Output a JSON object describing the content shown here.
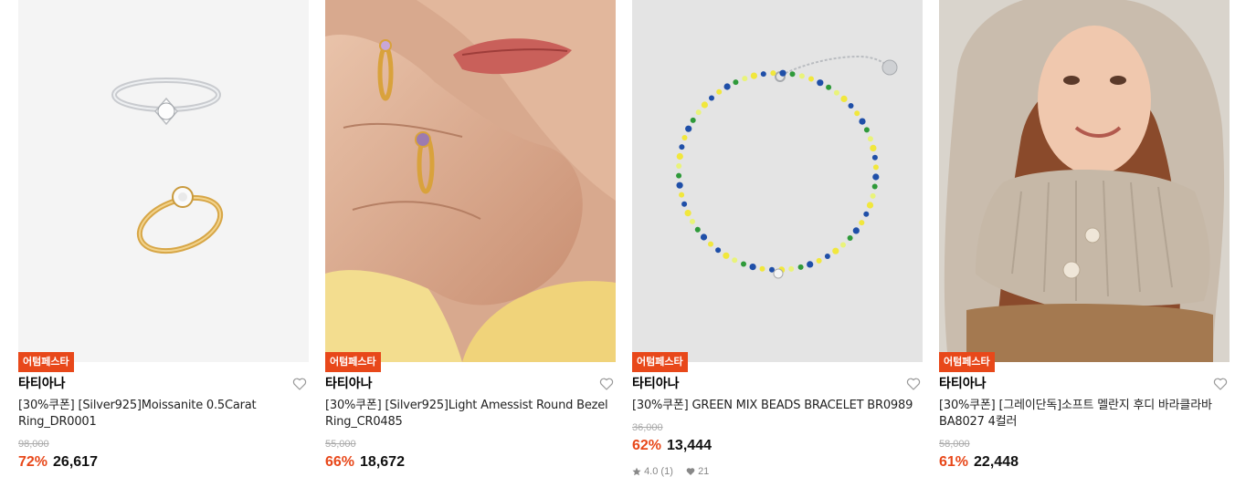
{
  "products": [
    {
      "badge": "어텀페스타",
      "brand": "타티아나",
      "name": "[30%쿠폰] [Silver925]Moissanite 0.5Carat Ring_DR0001",
      "original_price": "98,000",
      "discount": "72%",
      "price": "26,617",
      "image": "silver-and-gold-solitaire-rings"
    },
    {
      "badge": "어텀페스타",
      "brand": "타티아나",
      "name": "[30%쿠폰] [Silver925]Light Amessist Round Bezel Ring_CR0485",
      "original_price": "55,000",
      "discount": "66%",
      "price": "18,672",
      "image": "model-hand-wearing-gold-rings"
    },
    {
      "badge": "어텀페스타",
      "brand": "타티아나",
      "name": "[30%쿠폰] GREEN MIX BEADS BRACELET BR0989",
      "original_price": "36,000",
      "discount": "62%",
      "price": "13,444",
      "rating": "4.0",
      "review_count": "(1)",
      "likes": "21",
      "image": "beaded-bracelet"
    },
    {
      "badge": "어텀페스타",
      "brand": "타티아나",
      "name": "[30%쿠폰] [그레이단독]소프트 멜란지 후디 바라클라바 BA8027 4컬러",
      "original_price": "58,000",
      "discount": "61%",
      "price": "22,448",
      "image": "model-wearing-knit-balaclava"
    }
  ],
  "colors": {
    "accent": "#e8481a",
    "muted": "#aaaaaa"
  },
  "icons": {
    "wishlist": "heart-outline-icon",
    "rating": "star-icon",
    "likes": "heart-filled-icon"
  }
}
